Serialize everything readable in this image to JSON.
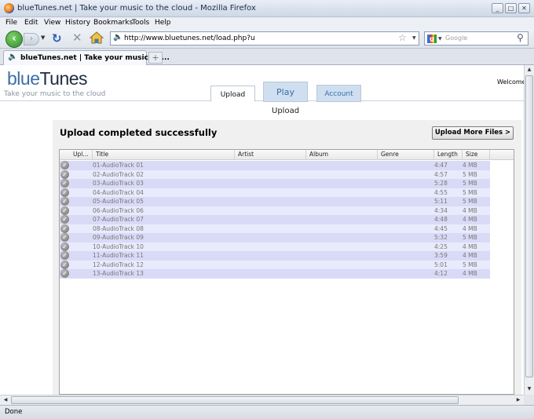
{
  "window": {
    "title": "blueTunes.net | Take your music to the cloud - Mozilla Firefox",
    "min": "_",
    "max": "□",
    "close": "✕"
  },
  "menu": [
    "File",
    "Edit",
    "View",
    "History",
    "Bookmarks",
    "Tools",
    "Help"
  ],
  "nav": {
    "url": "http://www.bluetunes.net/load.php?u",
    "search_placeholder": "Google"
  },
  "tab": {
    "label": "blueTunes.net | Take your music to ...",
    "new_tab": "+"
  },
  "site": {
    "logo_part1": "blue",
    "logo_part2": "Tunes",
    "tagline": "Take your music to the cloud",
    "welcome": "Welcome",
    "tabs": {
      "upload": "Upload",
      "play": "Play",
      "account": "Account"
    },
    "subtitle": "Upload",
    "heading": "Upload completed successfully",
    "more_button": "Upload More Files >"
  },
  "grid": {
    "columns": [
      "Upl...",
      "Title",
      "Artist",
      "Album",
      "Genre",
      "Length",
      "Size"
    ],
    "rows": [
      {
        "title": "01-AudioTrack 01",
        "length": "4:47",
        "size": "4 MB"
      },
      {
        "title": "02-AudioTrack 02",
        "length": "4:57",
        "size": "5 MB"
      },
      {
        "title": "03-AudioTrack 03",
        "length": "5:28",
        "size": "5 MB"
      },
      {
        "title": "04-AudioTrack 04",
        "length": "4:55",
        "size": "5 MB"
      },
      {
        "title": "05-AudioTrack 05",
        "length": "5:11",
        "size": "5 MB"
      },
      {
        "title": "06-AudioTrack 06",
        "length": "4:34",
        "size": "4 MB"
      },
      {
        "title": "07-AudioTrack 07",
        "length": "4:48",
        "size": "4 MB"
      },
      {
        "title": "08-AudioTrack 08",
        "length": "4:45",
        "size": "4 MB"
      },
      {
        "title": "09-AudioTrack 09",
        "length": "5:32",
        "size": "5 MB"
      },
      {
        "title": "10-AudioTrack 10",
        "length": "4:25",
        "size": "4 MB"
      },
      {
        "title": "11-AudioTrack 11",
        "length": "3:59",
        "size": "4 MB"
      },
      {
        "title": "12-AudioTrack 12",
        "length": "5:01",
        "size": "5 MB"
      },
      {
        "title": "13-AudioTrack 13",
        "length": "4:12",
        "size": "4 MB"
      }
    ]
  },
  "status": "Done"
}
